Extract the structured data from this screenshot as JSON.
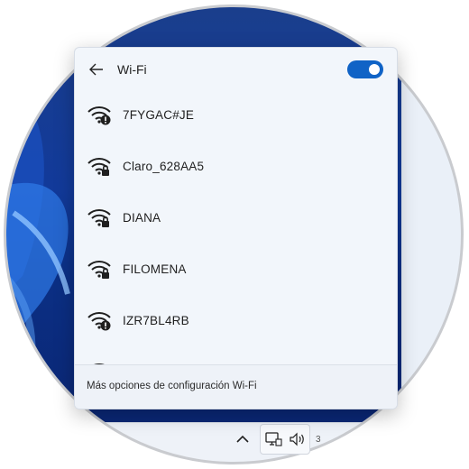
{
  "panel": {
    "back_icon": "arrow-left-icon",
    "title": "Wi-Fi",
    "wifi_toggle_on": true,
    "accent_color": "#1063c6"
  },
  "networks": [
    {
      "ssid": "7FYGAC#JE",
      "icon": "wifi-warning-icon",
      "badge": "!"
    },
    {
      "ssid": "Claro_628AA5",
      "icon": "wifi-secured-icon",
      "badge": "lock"
    },
    {
      "ssid": "DIANA",
      "icon": "wifi-secured-icon",
      "badge": "lock"
    },
    {
      "ssid": "FILOMENA",
      "icon": "wifi-secured-icon",
      "badge": "lock"
    },
    {
      "ssid": "IZR7BL4RB",
      "icon": "wifi-warning-icon",
      "badge": "!"
    },
    {
      "ssid": "",
      "icon": "wifi-secured-icon",
      "badge": "lock"
    }
  ],
  "footer": {
    "more_settings_label": "Más opciones de configuración Wi-Fi"
  },
  "taskbar": {
    "chevron_icon": "chevron-up-icon",
    "network_icon": "network-pc-icon",
    "volume_icon": "speaker-icon",
    "clock_fragment": "3"
  }
}
